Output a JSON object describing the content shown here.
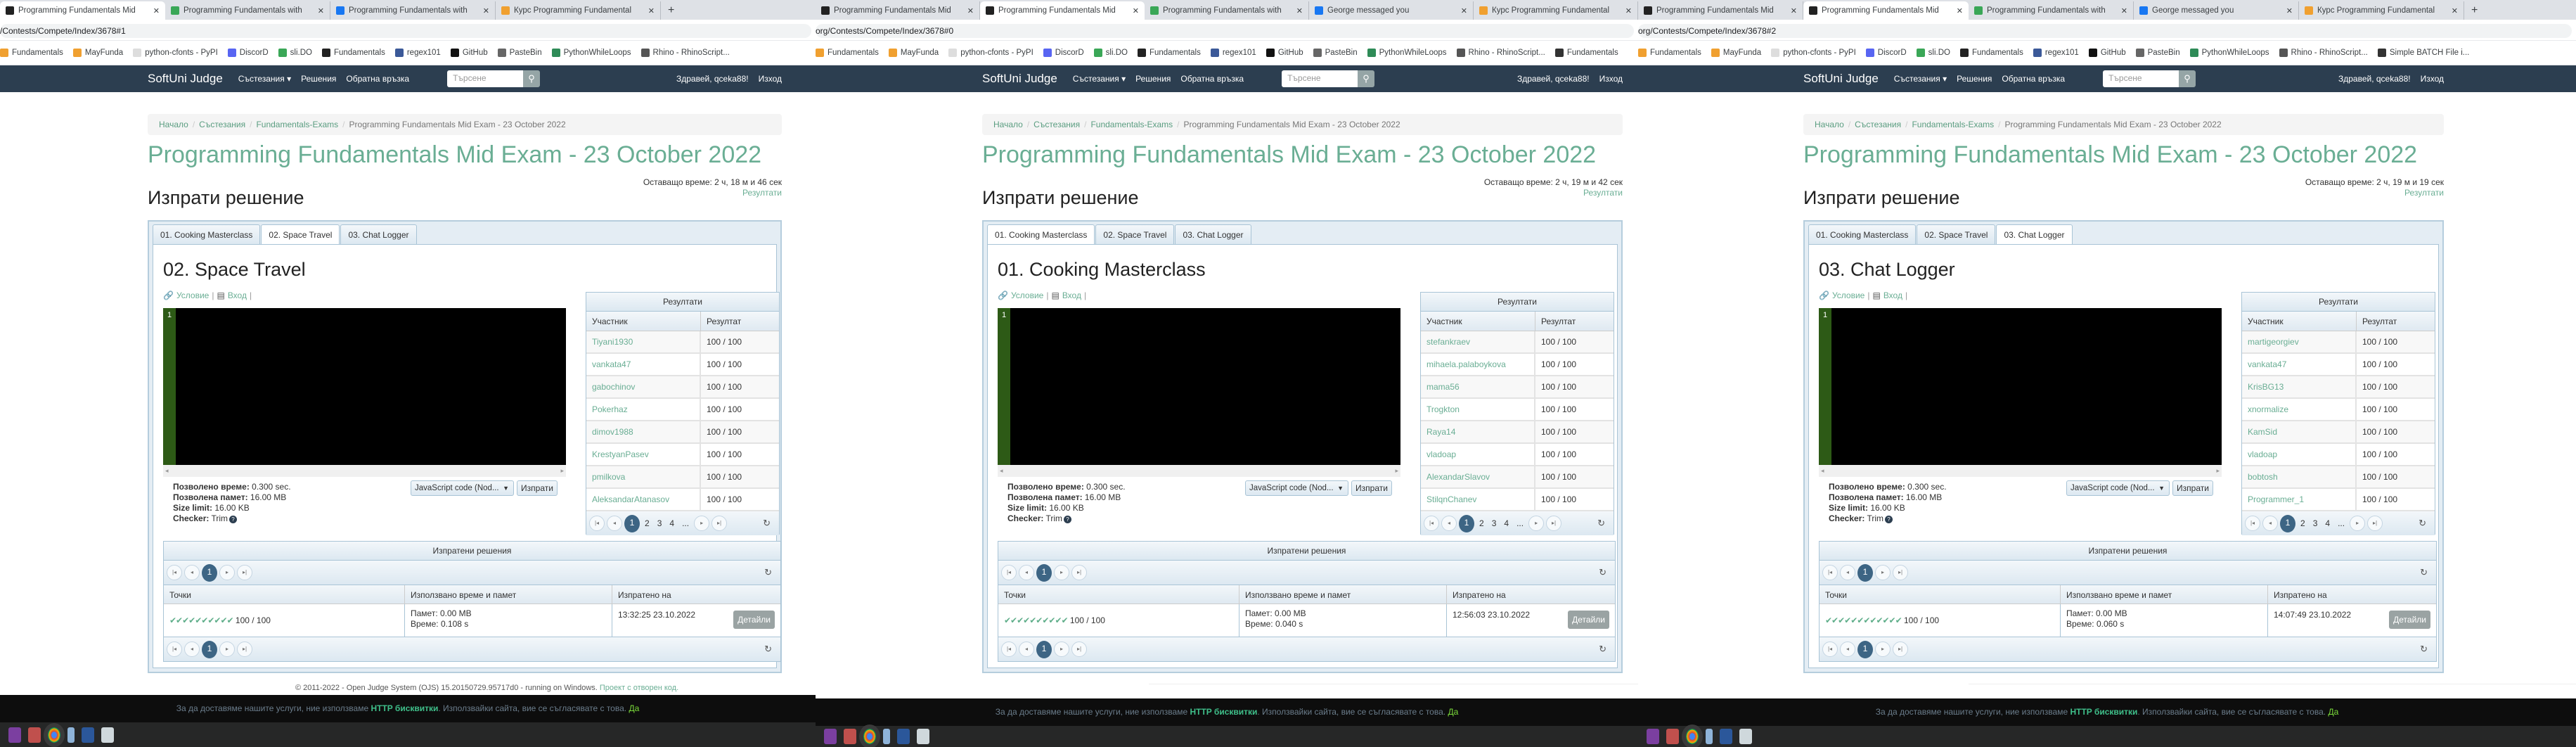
{
  "colors": {
    "navbar": "#2c3e50",
    "accent": "#6aae94",
    "pager_active": "#3d6584",
    "editor_gutter": "#2d5a16",
    "cookie_bg": "#0d0d0d"
  },
  "screens": [
    {
      "browser": {
        "tabs": [
          {
            "title": "Programming Fundamentals Mid",
            "icon": "judge-favicon",
            "active": true
          },
          {
            "title": "Programming Fundamentals with",
            "icon": "slido-favicon",
            "active": false
          },
          {
            "title": "Programming Fundamentals with",
            "icon": "facebook-favicon",
            "active": false
          },
          {
            "title": "Курс Programming Fundamental",
            "icon": "softuni-favicon",
            "active": false
          }
        ],
        "new_tab": "+",
        "url": "/Contests/Compete/Index/3678#1",
        "bookmarks": [
          "Fundamentals",
          "MayFunda",
          "python-cfonts - PyPI",
          "DiscorD",
          "sli.DO",
          "Fundamentals",
          "regex101",
          "GitHub",
          "PasteBin",
          "PythonWhileLoops",
          "Rhino - RhinoScript..."
        ]
      },
      "nav": {
        "brand": "SoftUni Judge",
        "menu": [
          "Състезания ▾",
          "Решения",
          "Обратна връзка"
        ],
        "search_placeholder": "Търсене",
        "greeting": "Здравей, qceka88!",
        "logout": "Изход"
      },
      "breadcrumb": [
        "Начало",
        "Състезания",
        "Fundamentals-Exams",
        "Programming Fundamentals Mid Exam - 23 October 2022"
      ],
      "title": "Programming Fundamentals Mid Exam - 23 October 2022",
      "remaining_time": "Оставащо време: 2 ч, 18 м и 46 сек",
      "results_link": "Резултати",
      "subtitle": "Изпрати решение",
      "problem_tabs": [
        "01. Cooking Masterclass",
        "02. Space Travel",
        "03. Chat Logger"
      ],
      "active_problem": 1,
      "problem": {
        "title": "02. Space Travel",
        "statement_link": "Условие",
        "input_link": "Вход",
        "line_number": "1",
        "limits": [
          {
            "label": "Позволено време:",
            "value": " 0.300 sec."
          },
          {
            "label": "Позволена памет:",
            "value": " 16.00 MB"
          },
          {
            "label": "Size limit:",
            "value": " 16.00 KB"
          },
          {
            "label": "Checker:",
            "value": " Trim"
          }
        ],
        "language": "JavaScript code (Nod...",
        "submit": "Изпрати"
      },
      "results": {
        "title": "Резултати",
        "columns": [
          "Участник",
          "Резултат"
        ],
        "rows": [
          {
            "user": "Tiyani1930",
            "score": "100 / 100"
          },
          {
            "user": "vankata47",
            "score": "100 / 100"
          },
          {
            "user": "gabochinov",
            "score": "100 / 100"
          },
          {
            "user": "Pokerhaz",
            "score": "100 / 100"
          },
          {
            "user": "dimov1988",
            "score": "100 / 100"
          },
          {
            "user": "KrestyanPasev",
            "score": "100 / 100"
          },
          {
            "user": "pmilkova",
            "score": "100 / 100"
          },
          {
            "user": "AleksandarAtanasov",
            "score": "100 / 100"
          }
        ],
        "pages": [
          "1",
          "2",
          "3",
          "4",
          "..."
        ]
      },
      "submissions": {
        "title": "Изпратени решения",
        "columns": [
          "Точки",
          "Използвано време и памет",
          "Изпратено на"
        ],
        "rows": [
          {
            "checks": 10,
            "score": "100 / 100",
            "memory": "Памет: 0.00 MB",
            "time": "Време: 0.108 s",
            "sent": "13:32:25 23.10.2022",
            "details": "Детайли"
          }
        ],
        "page": "1"
      },
      "footer": {
        "text": "© 2011-2022 - Open Judge System (OJS) 15.20150729.95717d0 - running on Windows. ",
        "link": "Проект с отворен код."
      },
      "cookie": {
        "text": "За да доставяме нашите услуги, ние използваме ",
        "link": "HTTP бисквитки",
        "text2": ". Използвайки сайта, вие се съгласявате с това. ",
        "accept": "Да"
      }
    },
    {
      "browser": {
        "tabs": [
          {
            "title": "Programming Fundamentals Mid",
            "icon": "judge-favicon",
            "active": false
          },
          {
            "title": "Programming Fundamentals Mid",
            "icon": "judge-favicon",
            "active": true
          },
          {
            "title": "Programming Fundamentals with",
            "icon": "slido-favicon",
            "active": false
          },
          {
            "title": "George messaged you",
            "icon": "facebook-favicon",
            "active": false
          },
          {
            "title": "Курс Programming Fundamental",
            "icon": "softuni-favicon",
            "active": false
          }
        ],
        "new_tab": "",
        "url": "org/Contests/Compete/Index/3678#0",
        "bookmarks": [
          "Fundamentals",
          "MayFunda",
          "python-cfonts - PyPI",
          "DiscorD",
          "sli.DO",
          "Fundamentals",
          "regex101",
          "GitHub",
          "PasteBin",
          "PythonWhileLoops",
          "Rhino - RhinoScript...",
          "Fundamentals"
        ]
      },
      "nav": {
        "brand": "SoftUni Judge",
        "menu": [
          "Състезания ▾",
          "Решения",
          "Обратна връзка"
        ],
        "search_placeholder": "Търсене",
        "greeting": "Здравей, qceka88!",
        "logout": "Изход"
      },
      "breadcrumb": [
        "Начало",
        "Състезания",
        "Fundamentals-Exams",
        "Programming Fundamentals Mid Exam - 23 October 2022"
      ],
      "title": "Programming Fundamentals Mid Exam - 23 October 2022",
      "remaining_time": "Оставащо време: 2 ч, 19 м и 42 сек",
      "results_link": "Резултати",
      "subtitle": "Изпрати решение",
      "problem_tabs": [
        "01. Cooking Masterclass",
        "02. Space Travel",
        "03. Chat Logger"
      ],
      "active_problem": 0,
      "problem": {
        "title": "01. Cooking Masterclass",
        "statement_link": "Условие",
        "input_link": "Вход",
        "line_number": "1",
        "limits": [
          {
            "label": "Позволено време:",
            "value": " 0.300 sec."
          },
          {
            "label": "Позволена памет:",
            "value": " 16.00 MB"
          },
          {
            "label": "Size limit:",
            "value": " 16.00 KB"
          },
          {
            "label": "Checker:",
            "value": " Trim"
          }
        ],
        "language": "JavaScript code (Nod...",
        "submit": "Изпрати"
      },
      "results": {
        "title": "Резултати",
        "columns": [
          "Участник",
          "Резултат"
        ],
        "rows": [
          {
            "user": "stefankraev",
            "score": "100 / 100"
          },
          {
            "user": "mihaela.palaboykova",
            "score": "100 / 100"
          },
          {
            "user": "mama56",
            "score": "100 / 100"
          },
          {
            "user": "Trogkton",
            "score": "100 / 100"
          },
          {
            "user": "Raya14",
            "score": "100 / 100"
          },
          {
            "user": "vladoap",
            "score": "100 / 100"
          },
          {
            "user": "AlexandarSlavov",
            "score": "100 / 100"
          },
          {
            "user": "StilqnChanev",
            "score": "100 / 100"
          }
        ],
        "pages": [
          "1",
          "2",
          "3",
          "4",
          "..."
        ]
      },
      "submissions": {
        "title": "Изпратени решения",
        "columns": [
          "Точки",
          "Използвано време и памет",
          "Изпратено на"
        ],
        "rows": [
          {
            "checks": 10,
            "score": "100 / 100",
            "memory": "Памет: 0.00 MB",
            "time": "Време: 0.040 s",
            "sent": "12:56:03 23.10.2022",
            "details": "Детайли"
          }
        ],
        "page": "1"
      },
      "cookie": {
        "text": "За да доставяме нашите услуги, ние използваме ",
        "link": "HTTP бисквитки",
        "text2": ". Използвайки сайта, вие се съгласявате с това. ",
        "accept": "Да"
      }
    },
    {
      "browser": {
        "tabs": [
          {
            "title": "Programming Fundamentals Mid",
            "icon": "judge-favicon",
            "active": false
          },
          {
            "title": "Programming Fundamentals Mid",
            "icon": "judge-favicon",
            "active": true
          },
          {
            "title": "Programming Fundamentals with",
            "icon": "slido-favicon",
            "active": false
          },
          {
            "title": "George messaged you",
            "icon": "facebook-favicon",
            "active": false
          },
          {
            "title": "Курс Programming Fundamental",
            "icon": "softuni-favicon",
            "active": false
          }
        ],
        "new_tab": "+",
        "url": "org/Contests/Compete/Index/3678#2",
        "bookmarks": [
          "Fundamentals",
          "MayFunda",
          "python-cfonts - PyPI",
          "DiscorD",
          "sli.DO",
          "Fundamentals",
          "regex101",
          "GitHub",
          "PasteBin",
          "PythonWhileLoops",
          "Rhino - RhinoScript...",
          "Simple BATCH File i..."
        ]
      },
      "nav": {
        "brand": "SoftUni Judge",
        "menu": [
          "Състезания ▾",
          "Решения",
          "Обратна връзка"
        ],
        "search_placeholder": "Търсене",
        "greeting": "Здравей, qceka88!",
        "logout": "Изход"
      },
      "breadcrumb": [
        "Начало",
        "Състезания",
        "Fundamentals-Exams",
        "Programming Fundamentals Mid Exam - 23 October 2022"
      ],
      "title": "Programming Fundamentals Mid Exam - 23 October 2022",
      "remaining_time": "Оставащо време: 2 ч, 19 м и 19 сек",
      "results_link": "Резултати",
      "subtitle": "Изпрати решение",
      "problem_tabs": [
        "01. Cooking Masterclass",
        "02. Space Travel",
        "03. Chat Logger"
      ],
      "active_problem": 2,
      "problem": {
        "title": "03. Chat Logger",
        "statement_link": "Условие",
        "input_link": "Вход",
        "line_number": "1",
        "limits": [
          {
            "label": "Позволено време:",
            "value": " 0.300 sec."
          },
          {
            "label": "Позволена памет:",
            "value": " 16.00 MB"
          },
          {
            "label": "Size limit:",
            "value": " 16.00 KB"
          },
          {
            "label": "Checker:",
            "value": " Trim"
          }
        ],
        "language": "JavaScript code (Nod...",
        "submit": "Изпрати"
      },
      "results": {
        "title": "Резултати",
        "columns": [
          "Участник",
          "Резултат"
        ],
        "rows": [
          {
            "user": "martigeorgiev",
            "score": "100 / 100"
          },
          {
            "user": "vankata47",
            "score": "100 / 100"
          },
          {
            "user": "KrisBG13",
            "score": "100 / 100"
          },
          {
            "user": "xnormalize",
            "score": "100 / 100"
          },
          {
            "user": "KamSid",
            "score": "100 / 100"
          },
          {
            "user": "vladoap",
            "score": "100 / 100"
          },
          {
            "user": "bobtosh",
            "score": "100 / 100"
          },
          {
            "user": "Programmer_1",
            "score": "100 / 100"
          }
        ],
        "pages": [
          "1",
          "2",
          "3",
          "4",
          "..."
        ]
      },
      "submissions": {
        "title": "Изпратени решения",
        "columns": [
          "Точки",
          "Използвано време и памет",
          "Изпратено на"
        ],
        "rows": [
          {
            "checks": 12,
            "score": "100 / 100",
            "memory": "Памет: 0.00 MB",
            "time": "Време: 0.060 s",
            "sent": "14:07:49 23.10.2022",
            "details": "Детайли"
          }
        ],
        "page": "1"
      },
      "cookie": {
        "text": "За да доставяме нашите услуги, ние използваме ",
        "link": "HTTP бисквитки",
        "text2": ". Използвайки сайта, вие се съгласявате с това. ",
        "accept": "Да"
      }
    }
  ]
}
